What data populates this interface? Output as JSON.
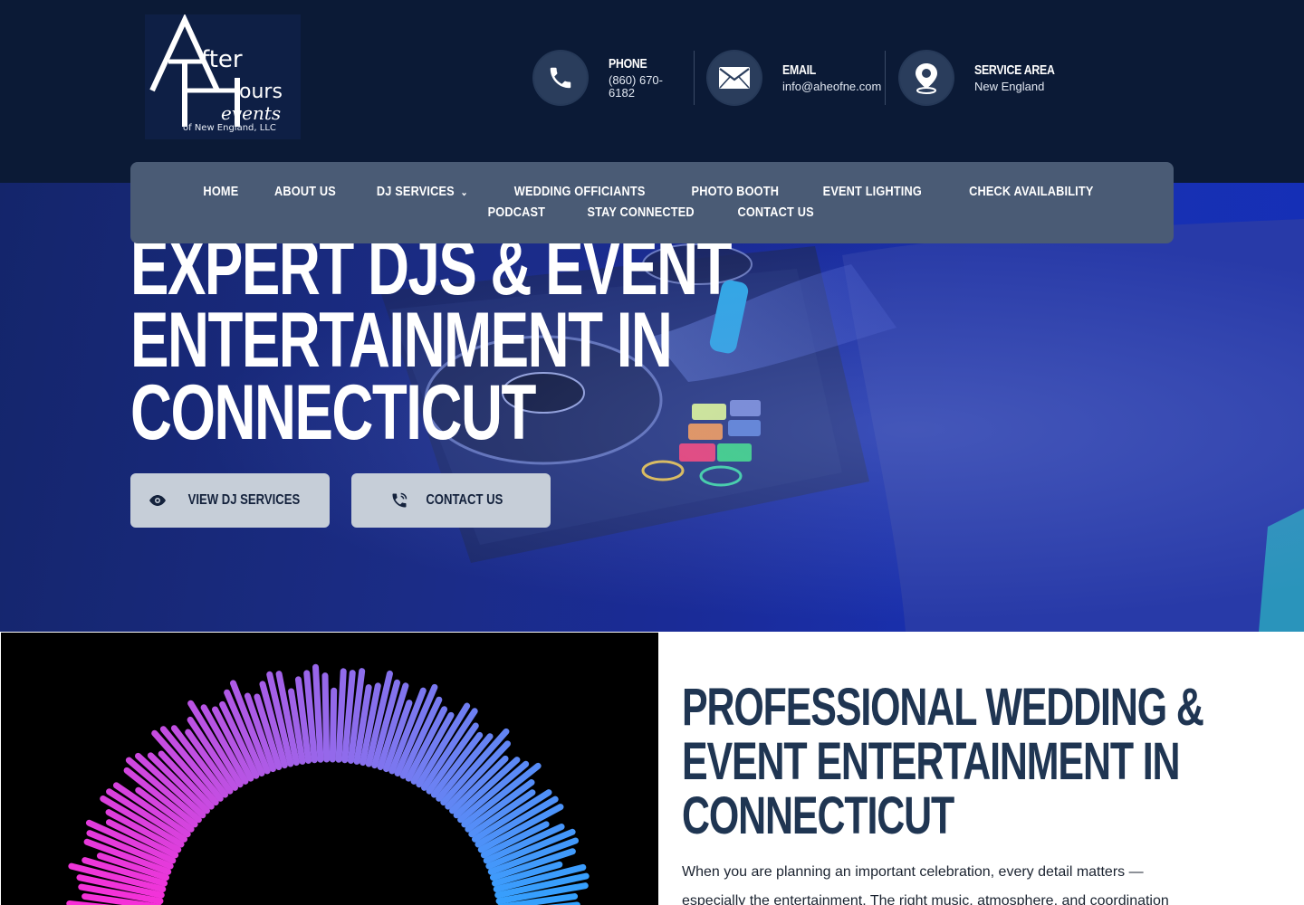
{
  "brand": {
    "logo_alt": "After Hours events of New England, LLC",
    "logo_subtitle": "of New England, LLC"
  },
  "contact": {
    "phone": {
      "label": "PHONE",
      "value_line1": "(860) 670-",
      "value_line2": "6182",
      "icon": "phone-icon"
    },
    "email": {
      "label": "EMAIL",
      "value": "info@aheofne.com",
      "icon": "envelope-icon"
    },
    "service_area": {
      "label": "SERVICE AREA",
      "value": "New England",
      "icon": "map-pin-icon"
    }
  },
  "nav": {
    "items": [
      {
        "label": "HOME"
      },
      {
        "label": "ABOUT US"
      },
      {
        "label": "DJ SERVICES",
        "has_dropdown": true
      },
      {
        "label": "WEDDING OFFICIANTS"
      },
      {
        "label": "PHOTO BOOTH"
      },
      {
        "label": "EVENT LIGHTING"
      },
      {
        "label": "CHECK AVAILABILITY"
      },
      {
        "label": "PODCAST"
      },
      {
        "label": "STAY CONNECTED"
      },
      {
        "label": "CONTACT US"
      }
    ]
  },
  "hero": {
    "title_lines": [
      "EXPERT DJS & EVENT",
      "ENTERTAINMENT IN",
      "CONNECTICUT"
    ],
    "buttons": [
      {
        "label": "VIEW DJ SERVICES",
        "icon": "eye-icon"
      },
      {
        "label": "CONTACT US",
        "icon": "phone-ringing-icon"
      }
    ]
  },
  "about": {
    "title_lines": [
      "PROFESSIONAL WEDDING &",
      "EVENT ENTERTAINMENT IN",
      "CONNECTICUT"
    ],
    "text": "When you are planning an important celebration, every detail matters — especially the entertainment. The right music, atmosphere, and coordination"
  },
  "colors": {
    "header_bg": "#0b1a36",
    "nav_bg": "#4a5b75",
    "button_bg": "#c6ced8",
    "heading_dark": "#1f3552"
  }
}
